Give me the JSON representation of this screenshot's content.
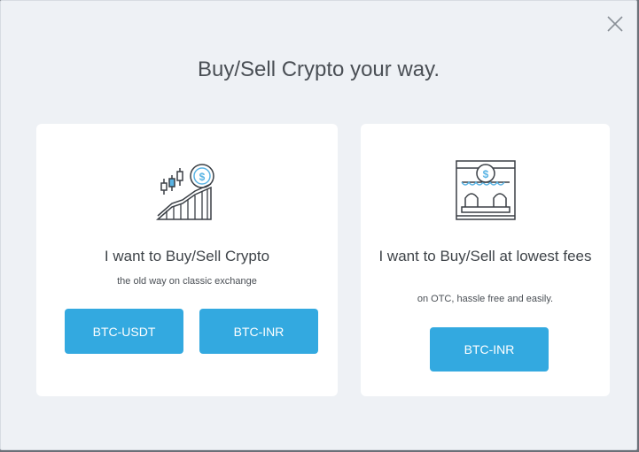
{
  "modal": {
    "title": "Buy/Sell Crypto your way.",
    "close_icon": "close-icon"
  },
  "cards": [
    {
      "icon": "chart-growth-coin-icon",
      "heading": "I want to Buy/Sell Crypto",
      "subtitle": "the old way on classic exchange",
      "buttons": [
        "BTC-USDT",
        "BTC-INR"
      ]
    },
    {
      "icon": "storefront-coin-icon",
      "heading": "I want to Buy/Sell at lowest fees",
      "subtitle": "on OTC, hassle free and easily.",
      "buttons": [
        "BTC-INR"
      ]
    }
  ],
  "colors": {
    "accent": "#33a9e0",
    "icon_stroke": "#3a3f45",
    "modal_bg": "#eef1f5"
  }
}
